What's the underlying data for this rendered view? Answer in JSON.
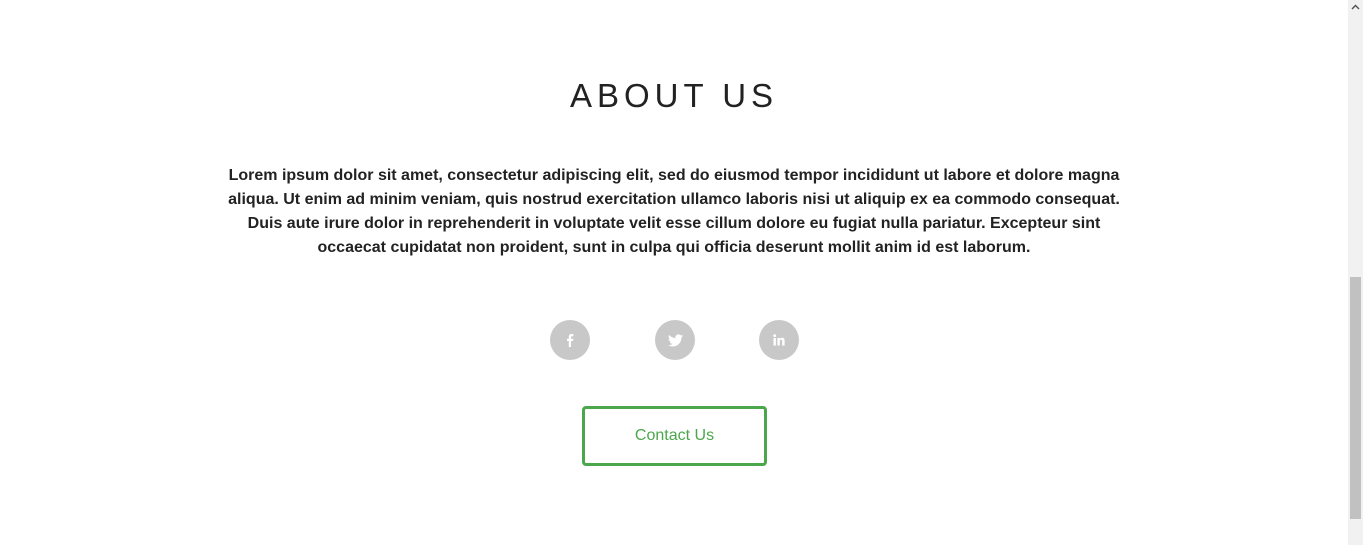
{
  "about": {
    "title": "ABOUT US",
    "body": "Lorem ipsum dolor sit amet, consectetur adipiscing elit, sed do eiusmod tempor incididunt ut labore et dolore magna aliqua. Ut enim ad minim veniam, quis nostrud exercitation ullamco laboris nisi ut aliquip ex ea commodo consequat. Duis aute irure dolor in reprehenderit in voluptate velit esse cillum dolore eu fugiat nulla pariatur. Excepteur sint occaecat cupidatat non proident, sunt in culpa qui officia deserunt mollit anim id est laborum."
  },
  "socials": [
    {
      "name": "facebook",
      "icon": "facebook-icon"
    },
    {
      "name": "twitter",
      "icon": "twitter-icon"
    },
    {
      "name": "linkedin",
      "icon": "linkedin-icon"
    }
  ],
  "contact": {
    "label": "Contact Us"
  },
  "colors": {
    "accent": "#4ca64c",
    "social_bg": "#c8c8c8",
    "text": "#222222"
  }
}
